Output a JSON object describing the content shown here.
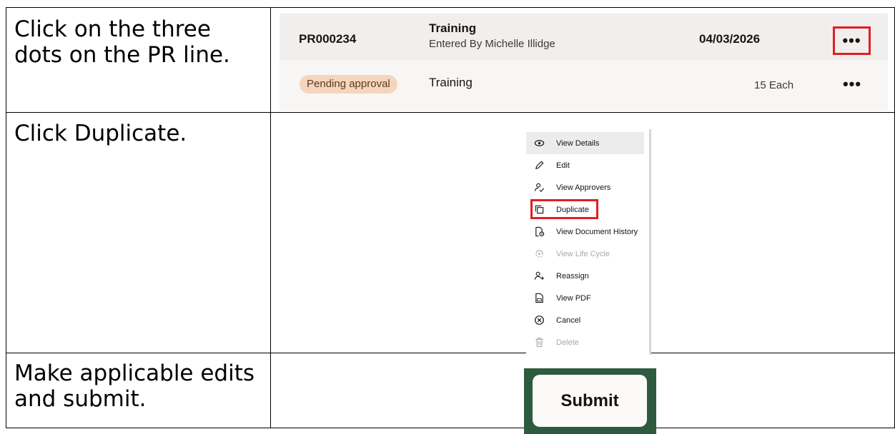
{
  "steps": [
    {
      "instruction": "Click on the three dots on the PR line."
    },
    {
      "instruction": "Click Duplicate."
    },
    {
      "instruction": "Make applicable edits and submit."
    }
  ],
  "pr_line": {
    "number": "PR000234",
    "title": "Training",
    "entered_by": "Entered By Michelle Illidge",
    "date": "04/03/2026",
    "status_badge": "Pending approval",
    "category": "Training",
    "quantity": "15 Each",
    "actions_glyph": "•••",
    "highlight_color": "#e01e26",
    "badge_color": "#f5d5bd"
  },
  "menu": {
    "items": [
      {
        "label": "View Details",
        "icon": "eye-icon"
      },
      {
        "label": "Edit",
        "icon": "pencil-icon"
      },
      {
        "label": "View Approvers",
        "icon": "user-check-icon"
      },
      {
        "label": "Duplicate",
        "icon": "copy-icon"
      },
      {
        "label": "View Document History",
        "icon": "document-history-icon"
      },
      {
        "label": "View Life Cycle",
        "icon": "lifecycle-icon",
        "disabled": true
      },
      {
        "label": "Reassign",
        "icon": "user-add-icon"
      },
      {
        "label": "View PDF",
        "icon": "pdf-icon"
      },
      {
        "label": "Cancel",
        "icon": "cancel-circle-icon"
      },
      {
        "label": "Delete",
        "icon": "trash-icon",
        "disabled": true
      }
    ]
  },
  "submit": {
    "label": "Submit",
    "background_color": "#2e5a3f"
  }
}
